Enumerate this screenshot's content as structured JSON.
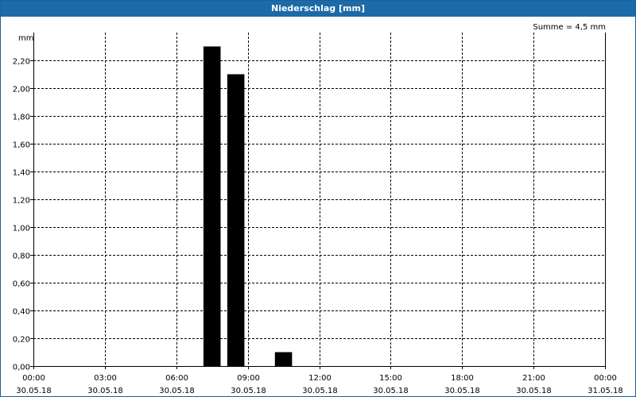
{
  "window": {
    "title": "Niederschlag [mm]"
  },
  "chart_data": {
    "type": "bar",
    "title": "Niederschlag [mm]",
    "ylabel": "mm",
    "summary": "Summe = 4,5 mm",
    "ylim": [
      0,
      2.4
    ],
    "xlim_hours": [
      0,
      24
    ],
    "grid": true,
    "bar_color": "#000000",
    "grid_color": "#000000",
    "y_ticks": [
      {
        "value": 0.0,
        "label": "0,00"
      },
      {
        "value": 0.2,
        "label": "0,20"
      },
      {
        "value": 0.4,
        "label": "0,40"
      },
      {
        "value": 0.6,
        "label": "0,60"
      },
      {
        "value": 0.8,
        "label": "0,80"
      },
      {
        "value": 1.0,
        "label": "1,00"
      },
      {
        "value": 1.2,
        "label": "1,20"
      },
      {
        "value": 1.4,
        "label": "1,40"
      },
      {
        "value": 1.6,
        "label": "1,60"
      },
      {
        "value": 1.8,
        "label": "1,80"
      },
      {
        "value": 2.0,
        "label": "2,00"
      },
      {
        "value": 2.2,
        "label": "2,20"
      }
    ],
    "x_ticks": [
      {
        "hour": 0,
        "time": "00:00",
        "date": "30.05.18"
      },
      {
        "hour": 3,
        "time": "03:00",
        "date": "30.05.18"
      },
      {
        "hour": 6,
        "time": "06:00",
        "date": "30.05.18"
      },
      {
        "hour": 9,
        "time": "09:00",
        "date": "30.05.18"
      },
      {
        "hour": 12,
        "time": "12:00",
        "date": "30.05.18"
      },
      {
        "hour": 15,
        "time": "15:00",
        "date": "30.05.18"
      },
      {
        "hour": 18,
        "time": "18:00",
        "date": "30.05.18"
      },
      {
        "hour": 21,
        "time": "21:00",
        "date": "30.05.18"
      },
      {
        "hour": 24,
        "time": "00:00",
        "date": "31.05.18"
      }
    ],
    "bars": [
      {
        "start_hour": 7,
        "end_hour": 8,
        "value": 2.3
      },
      {
        "start_hour": 8,
        "end_hour": 9,
        "value": 2.1
      },
      {
        "start_hour": 10,
        "end_hour": 11,
        "value": 0.1
      }
    ]
  }
}
